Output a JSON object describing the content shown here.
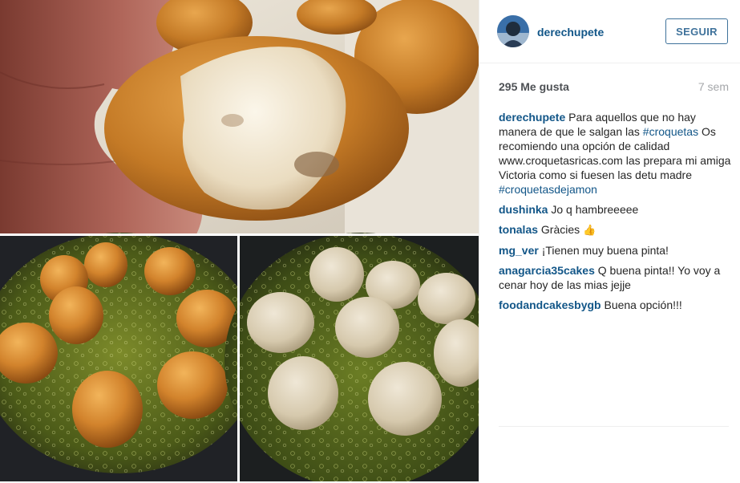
{
  "post": {
    "username": "derechupete",
    "follow_label": "SEGUIR",
    "likes": "295 Me gusta",
    "time_ago": "7 sem",
    "icons": {
      "avatar": "user-avatar",
      "thumbs_up": "thumbs-up-icon"
    },
    "colors": {
      "link": "#125688",
      "follow": "#3f729b",
      "muted": "#a5a7aa"
    },
    "caption": {
      "user": "derechupete",
      "text_1": "Para aquellos que no hay manera de que le salgan las ",
      "tag_1": "#croquetas",
      "text_2": " Os recomiendo una opción de calidad www.croquetasricas.com las prepara mi amiga Victoria como si fuesen las detu madre ",
      "tag_2": "#croquetasdejamon"
    },
    "comments": [
      {
        "user": "dushinka",
        "text": "Jo q hambreeeee"
      },
      {
        "user": "tonalas",
        "text": "Gràcies"
      },
      {
        "user": "mg_ver",
        "text": "¡Tienen muy buena pinta!"
      },
      {
        "user": "anagarcia35cakes",
        "text": "Q buena pinta!! Yo voy a cenar hoy de las mias jejje"
      },
      {
        "user": "foodandcakesbygb",
        "text": "Buena opción!!!"
      }
    ]
  }
}
